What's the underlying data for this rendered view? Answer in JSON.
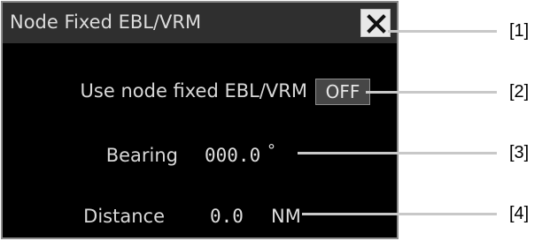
{
  "dialog": {
    "title": "Node Fixed EBL/VRM",
    "close_icon": "close-icon",
    "use_label": "Use node fixed EBL/VRM",
    "toggle_value": "OFF",
    "bearing_label": "Bearing",
    "bearing_value": "000.0",
    "bearing_unit": "°",
    "distance_label": "Distance",
    "distance_value": "0.0",
    "distance_unit": "NM"
  },
  "callouts": [
    "[1]",
    "[2]",
    "[3]",
    "[4]"
  ],
  "colors": {
    "dialog_background": "#000000",
    "titlebar": "#2f2f2f",
    "text": "#d8d8d8",
    "button": "#464646"
  }
}
